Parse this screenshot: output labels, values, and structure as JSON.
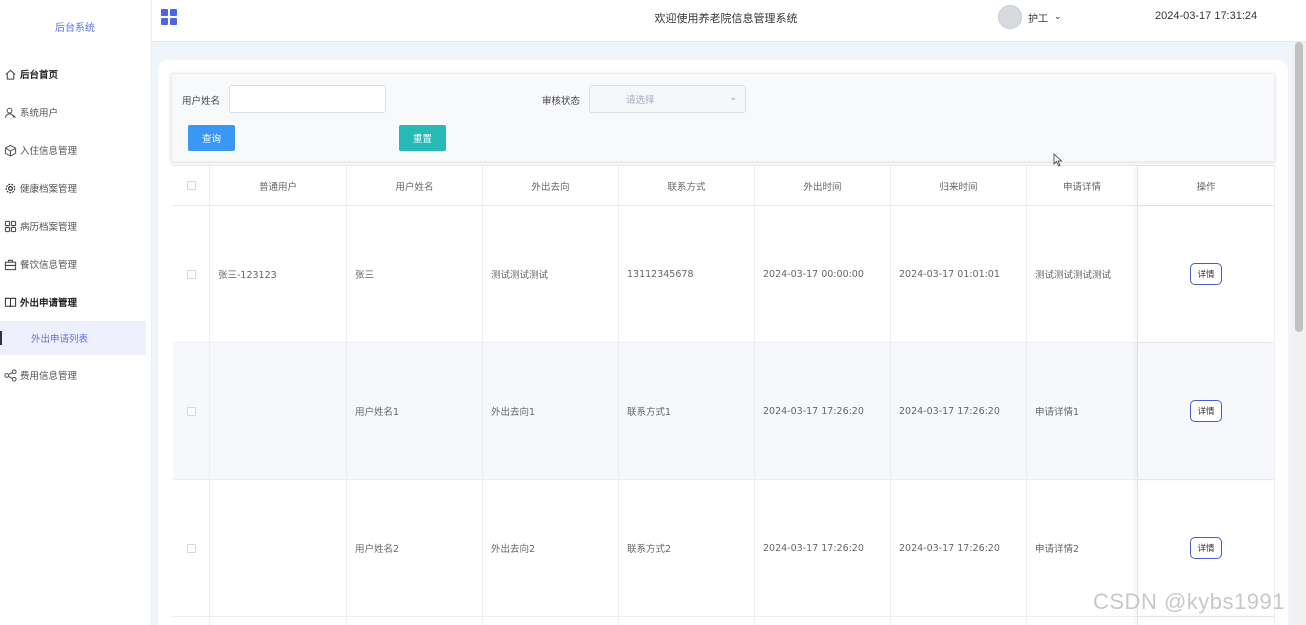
{
  "sidebar": {
    "brand": "后台系统",
    "items": [
      {
        "label": "后台首页",
        "icon": "home-icon"
      },
      {
        "label": "系统用户",
        "icon": "user-icon"
      },
      {
        "label": "入住信息管理",
        "icon": "cube-icon"
      },
      {
        "label": "健康档案管理",
        "icon": "gear-icon"
      },
      {
        "label": "病历档案管理",
        "icon": "grid-four-icon"
      },
      {
        "label": "餐饮信息管理",
        "icon": "briefcase-icon"
      },
      {
        "label": "外出申请管理",
        "icon": "book-icon"
      },
      {
        "label": "费用信息管理",
        "icon": "share-icon"
      }
    ],
    "submenu_active": "外出申请列表"
  },
  "header": {
    "title": "欢迎使用养老院信息管理系统",
    "role": "护工",
    "datetime": "2024-03-17 17:31:24"
  },
  "search": {
    "username_label": "用户姓名",
    "username_value": "",
    "status_label": "审核状态",
    "status_placeholder": "请选择",
    "query_label": "查询",
    "reset_label": "重置"
  },
  "table": {
    "headers": [
      "普通用户",
      "用户姓名",
      "外出去向",
      "联系方式",
      "外出时间",
      "归来时间",
      "申请详情",
      "操作"
    ],
    "rows": [
      {
        "user": "张三-123123",
        "name": "张三",
        "dest": "测试测试测试",
        "contact": "13112345678",
        "out_time": "2024-03-17 00:00:00",
        "back_time": "2024-03-17 01:01:01",
        "detail": "测试测试测试测试",
        "action": "详情"
      },
      {
        "user": "",
        "name": "用户姓名1",
        "dest": "外出去向1",
        "contact": "联系方式1",
        "out_time": "2024-03-17 17:26:20",
        "back_time": "2024-03-17 17:26:20",
        "detail": "申请详情1",
        "action": "详情"
      },
      {
        "user": "",
        "name": "用户姓名2",
        "dest": "外出去向2",
        "contact": "联系方式2",
        "out_time": "2024-03-17 17:26:20",
        "back_time": "2024-03-17 17:26:20",
        "detail": "申请详情2",
        "action": "详情"
      }
    ]
  },
  "watermark": "CSDN @kybs1991",
  "colors": {
    "accent": "#5b73e8",
    "query_button": "#3a98f4",
    "reset_button": "#26b9b6"
  }
}
